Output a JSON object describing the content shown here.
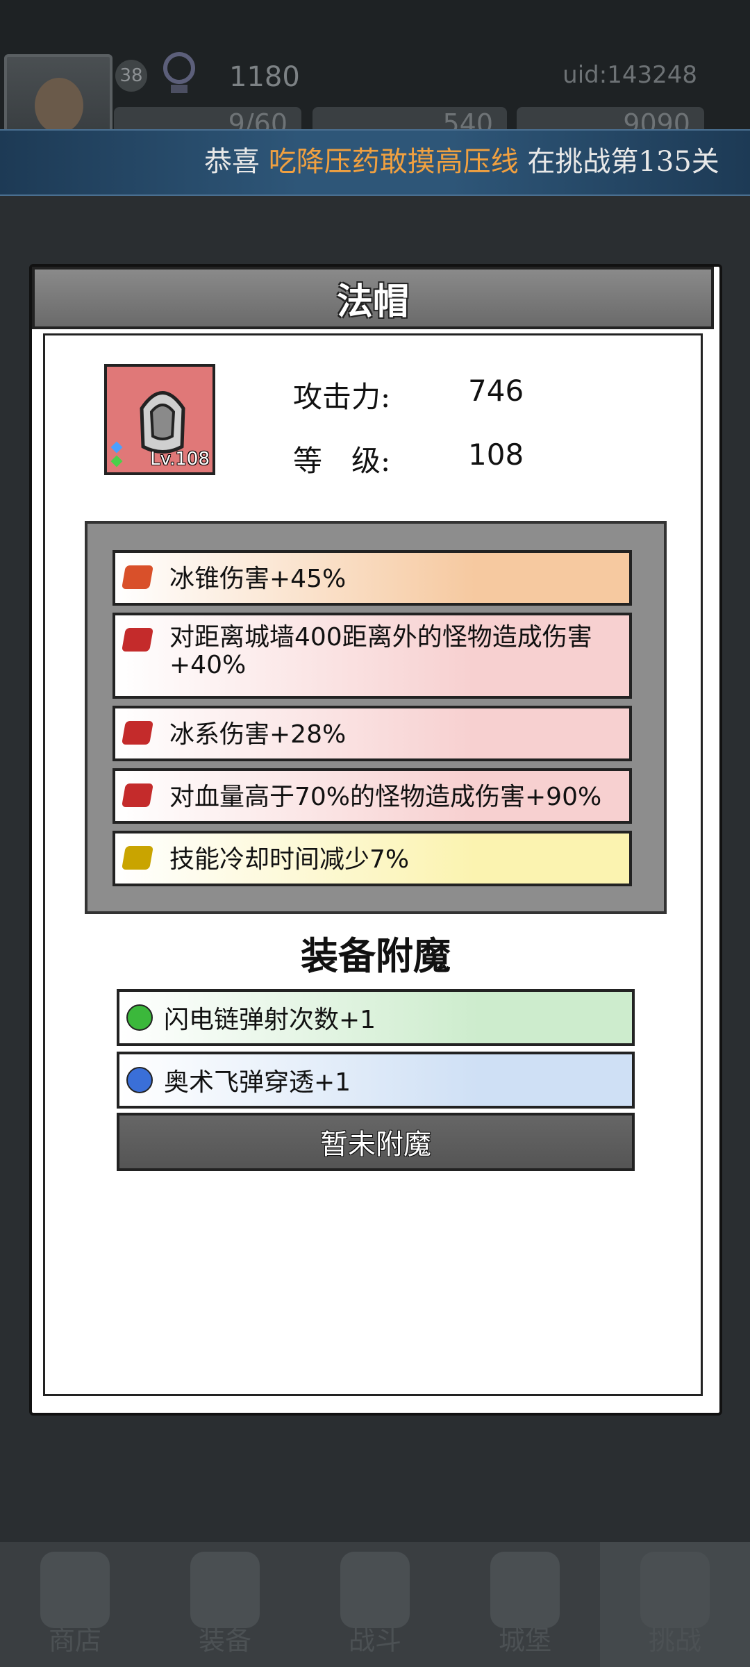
{
  "hud": {
    "level": "38",
    "power": "1180",
    "uid": "uid:143248",
    "resources": [
      "9/60",
      "540",
      "9090"
    ]
  },
  "ticker": {
    "prefix": "恭喜 ",
    "player": "吃降压药敢摸高压线",
    "suffix": " 在挑战第135关"
  },
  "modal": {
    "title": "法帽",
    "item_level": "Lv.108",
    "stats": [
      {
        "label": "攻击力:",
        "value": "746"
      },
      {
        "label": "等　级:",
        "value": "108"
      }
    ],
    "affixes": [
      {
        "text": "冰锥伤害+45%",
        "gem_color": "#d9502a",
        "row_color": "#f6c9a0"
      },
      {
        "text": "对距离城墙400距离外的怪物造成伤害+40%",
        "gem_color": "#c42b2b",
        "row_color": "#f7d0d0"
      },
      {
        "text": "冰系伤害+28%",
        "gem_color": "#c42b2b",
        "row_color": "#f7d0d0"
      },
      {
        "text": "对血量高于70%的怪物造成伤害+90%",
        "gem_color": "#c42b2b",
        "row_color": "#f7d0d0"
      },
      {
        "text": "技能冷却时间减少7%",
        "gem_color": "#c9a400",
        "row_color": "#fbf3b0"
      }
    ],
    "enchant_heading": "装备附魔",
    "enchants": [
      {
        "text": "闪电链弹射次数+1",
        "gem_color": "#3bb83b",
        "row_color": "#cdeccd"
      },
      {
        "text": "奥术飞弹穿透+1",
        "gem_color": "#3a6fd8",
        "row_color": "#cfe0f5"
      }
    ],
    "enchant_empty": "暂未附魔"
  },
  "nav": [
    "商店",
    "装备",
    "战斗",
    "城堡",
    "挑战"
  ]
}
